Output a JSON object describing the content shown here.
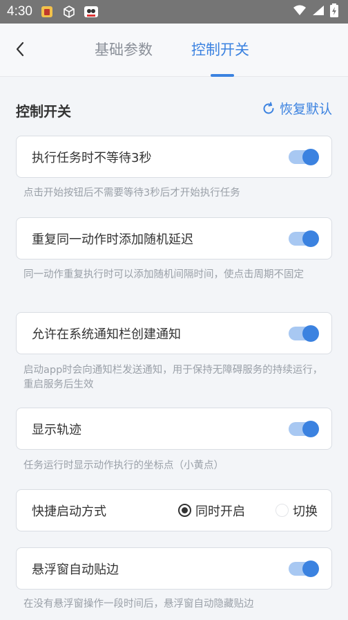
{
  "status_bar": {
    "time": "4:30"
  },
  "header": {
    "tabs": [
      {
        "label": "基础参数",
        "active": false
      },
      {
        "label": "控制开关",
        "active": true
      }
    ]
  },
  "section": {
    "title": "控制开关",
    "reset_label": "恢复默认"
  },
  "settings": [
    {
      "label": "执行任务时不等待3秒",
      "on": true,
      "desc": "点击开始按钮后不需要等待3秒后才开始执行任务"
    },
    {
      "label": "重复同一动作时添加随机延迟",
      "on": true,
      "desc": "同一动作重复执行时可以添加随机间隔时间，使点击周期不固定"
    },
    {
      "label": "允许在系统通知栏创建通知",
      "on": true,
      "desc": "启动app时会向通知栏发送通知，用于保持无障碍服务的持续运行，重启服务后生效"
    },
    {
      "label": "显示轨迹",
      "on": true,
      "desc": "任务运行时显示动作执行的坐标点（小黄点）"
    },
    {
      "label": "快捷启动方式",
      "options": [
        "同时开启",
        "切换"
      ],
      "selected": "同时开启"
    },
    {
      "label": "悬浮窗自动贴边",
      "on": true,
      "desc": "在没有悬浮窗操作一段时间后，悬浮窗自动隐藏贴边"
    }
  ],
  "colors": {
    "accent": "#3b82e0",
    "toggle_track": "#a8c8f2",
    "status_bar": "#757575"
  }
}
